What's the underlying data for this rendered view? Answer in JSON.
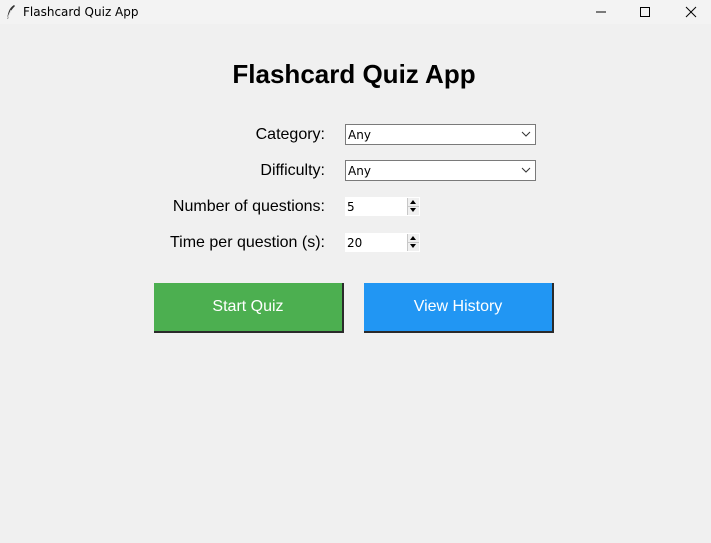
{
  "window": {
    "title": "Flashcard Quiz App",
    "icon": "feather-icon"
  },
  "heading": "Flashcard Quiz App",
  "form": {
    "category": {
      "label": "Category:",
      "value": "Any"
    },
    "difficulty": {
      "label": "Difficulty:",
      "value": "Any"
    },
    "num_questions": {
      "label": "Number of questions:",
      "value": "5"
    },
    "time_per_question": {
      "label": "Time per question (s):",
      "value": "20"
    }
  },
  "buttons": {
    "start": {
      "label": "Start Quiz",
      "color": "#4caf50"
    },
    "history": {
      "label": "View History",
      "color": "#2196f3"
    }
  }
}
